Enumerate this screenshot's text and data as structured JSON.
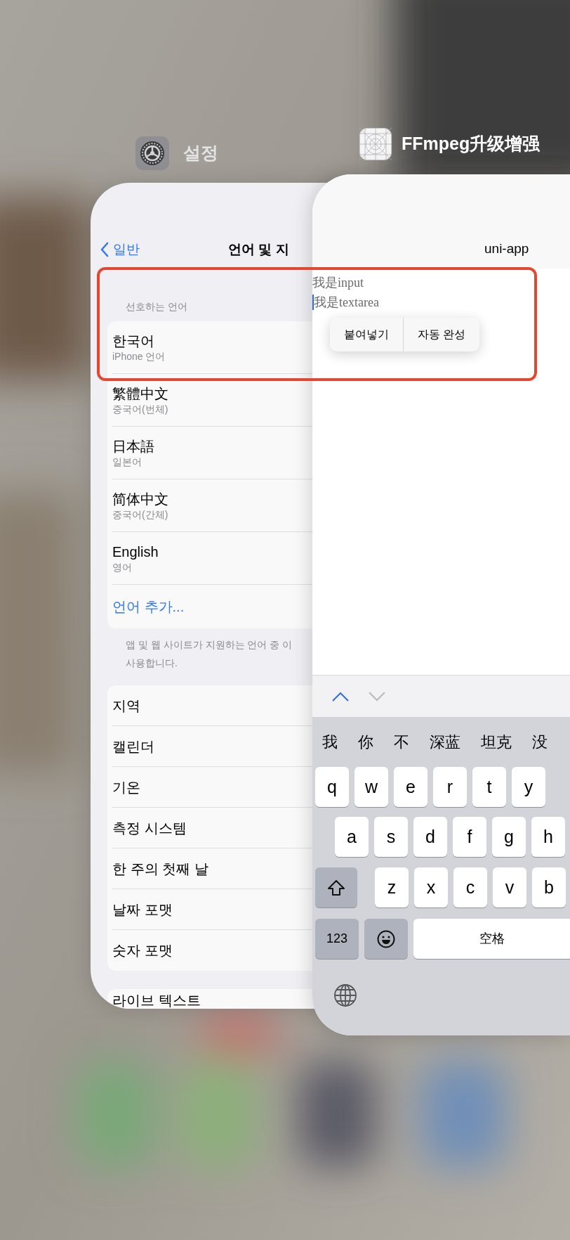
{
  "settings_card": {
    "app_name": "설정",
    "nav": {
      "back": "일반",
      "title": "언어 및 지"
    },
    "section_header": "선호하는 언어",
    "languages": [
      {
        "name": "한국어",
        "subtitle": "iPhone 언어"
      },
      {
        "name": "繁體中文",
        "subtitle": "중국어(번체)"
      },
      {
        "name": "日本語",
        "subtitle": "일본어"
      },
      {
        "name": "简体中文",
        "subtitle": "중국어(간체)"
      },
      {
        "name": "English",
        "subtitle": "영어"
      }
    ],
    "add_language": "언어 추가...",
    "footer": [
      "앱 및 웹 사이트가 지원하는 언어 중 이",
      "사용합니다."
    ],
    "region_items": [
      "지역",
      "캘린더",
      "기온",
      "측정 시스템",
      "한 주의 첫째 날",
      "날짜 포맷",
      "숫자 포맷"
    ],
    "next_group_items": [
      "라이브 텍스트"
    ]
  },
  "app_card": {
    "app_name": "FFmpeg升级增强",
    "title": "uni-app",
    "input_value": "我是input",
    "textarea_value": "我是textarea",
    "context_menu": [
      "붙여넣기",
      "자동 완성"
    ],
    "keyboard": {
      "previous_enabled": true,
      "next_enabled": false,
      "candidates": [
        "我",
        "你",
        "不",
        "深蓝",
        "坦克",
        "没"
      ],
      "rows": [
        [
          "q",
          "w",
          "e",
          "r",
          "t",
          "y"
        ],
        [
          "a",
          "s",
          "d",
          "f",
          "g",
          "h"
        ],
        [
          "z",
          "x",
          "c",
          "v",
          "b"
        ]
      ],
      "numbers_key": "123",
      "space_key": "空格"
    }
  }
}
